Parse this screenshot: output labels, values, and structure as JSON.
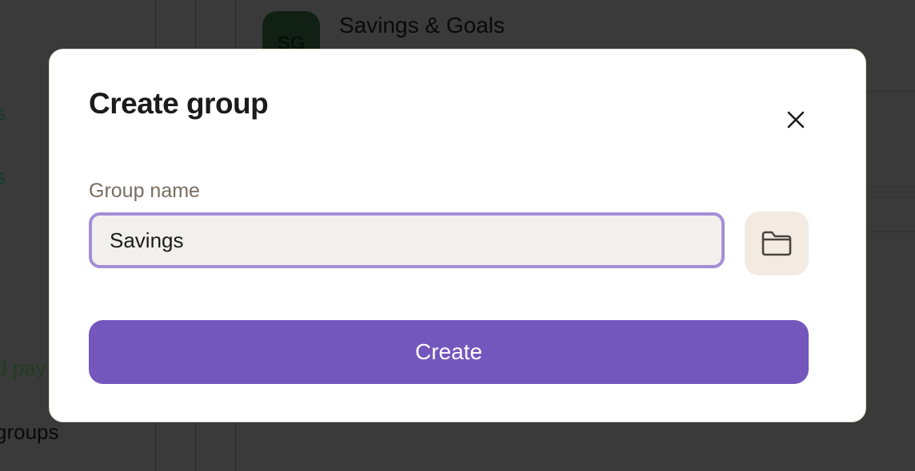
{
  "background": {
    "sidebar_items": [
      "s",
      "s",
      "d pay",
      "groups"
    ],
    "list_item": {
      "avatar_initials": "SG",
      "title": "Savings & Goals"
    }
  },
  "modal": {
    "title": "Create group",
    "close_icon": "close-icon",
    "field_label": "Group name",
    "input_value": "Savings",
    "folder_icon": "folder-icon",
    "create_label": "Create"
  },
  "colors": {
    "accent": "#7357bd",
    "input_border": "#a48ed6",
    "input_bg": "#f2f0ec",
    "folder_bg": "#f3ebe1",
    "label": "#7a6d61"
  }
}
